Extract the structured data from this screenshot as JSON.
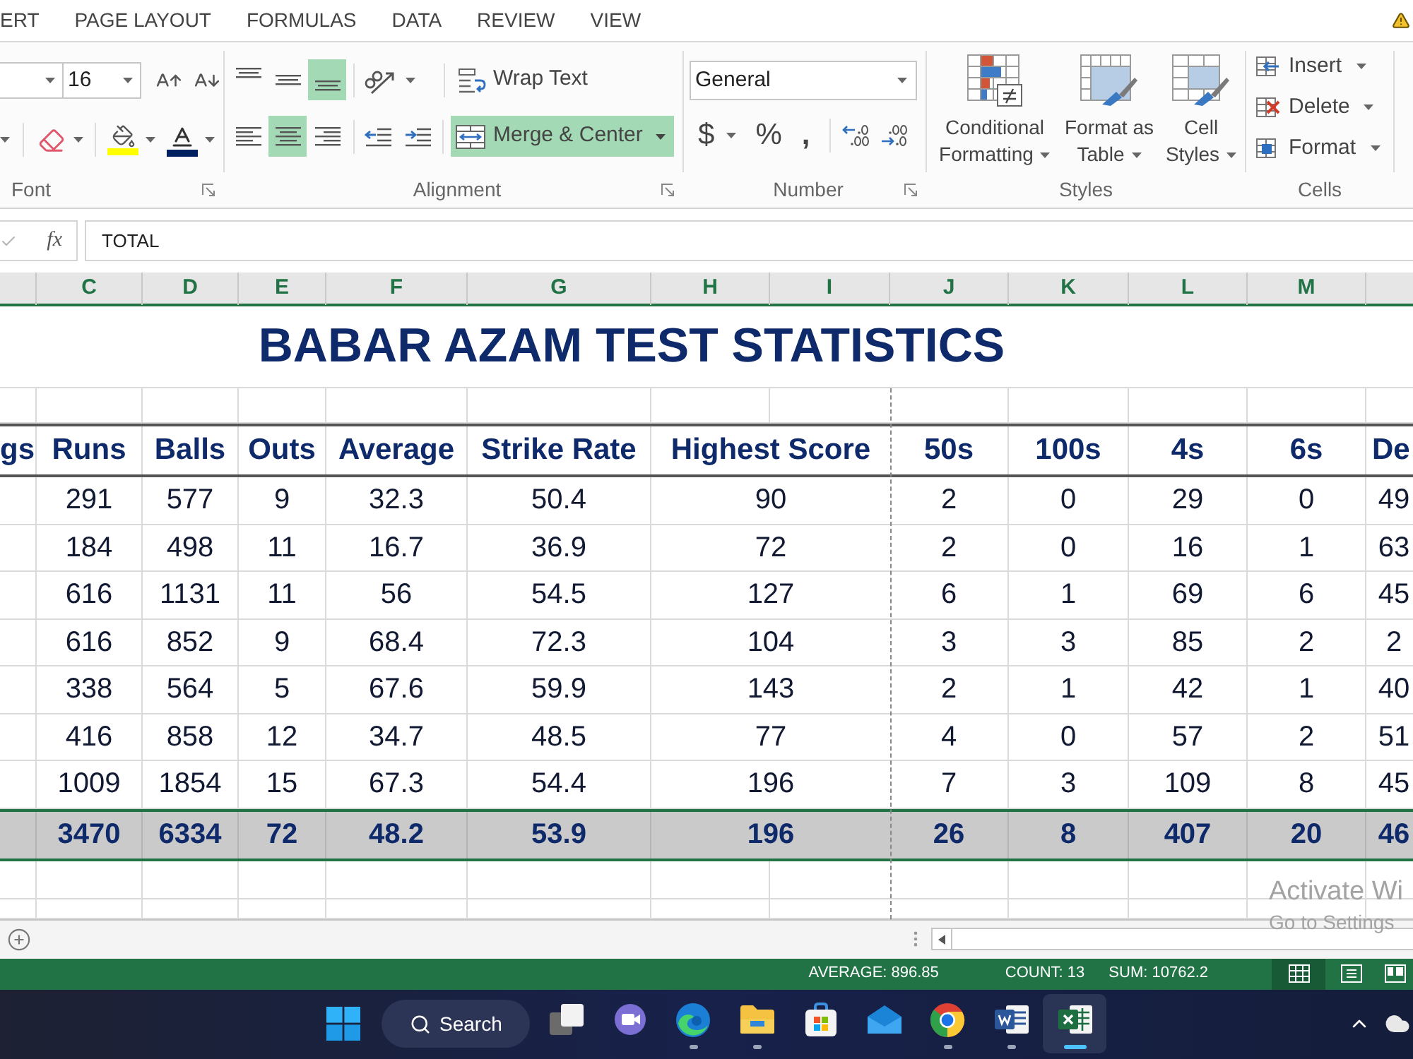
{
  "ribbon_tabs": [
    {
      "label": "ERT"
    },
    {
      "label": "PAGE LAYOUT"
    },
    {
      "label": "FORMULAS"
    },
    {
      "label": "DATA"
    },
    {
      "label": "REVIEW"
    },
    {
      "label": "VIEW"
    }
  ],
  "ribbon": {
    "font": {
      "label": "Font",
      "size": "16"
    },
    "alignment": {
      "label": "Alignment",
      "vertical": [
        {
          "kind": "top",
          "selected": false
        },
        {
          "kind": "middle",
          "selected": false
        },
        {
          "kind": "bottom",
          "selected": true
        }
      ],
      "horizontal": [
        {
          "kind": "left",
          "selected": false
        },
        {
          "kind": "center",
          "selected": true
        },
        {
          "kind": "right",
          "selected": false
        }
      ],
      "wrap_text": {
        "label": "Wrap Text",
        "selected": false
      },
      "merge": {
        "label": "Merge & Center",
        "selected": true
      }
    },
    "number": {
      "label": "Number",
      "format": "General",
      "symbols": [
        {
          "label": "$",
          "dropdown": true
        },
        {
          "label": "%",
          "dropdown": false
        },
        {
          "label": ",",
          "dropdown": false
        }
      ]
    },
    "styles": {
      "label": "Styles",
      "buttons": [
        {
          "kind": "conditional",
          "lines": [
            "Conditional",
            "Formatting"
          ]
        },
        {
          "kind": "table",
          "lines": [
            "Format as",
            "Table"
          ]
        },
        {
          "kind": "cell_styles",
          "lines": [
            "Cell",
            "Styles"
          ]
        }
      ]
    },
    "cells": {
      "label": "Cells",
      "buttons": [
        {
          "kind": "insert",
          "label": "Insert"
        },
        {
          "kind": "delete",
          "label": "Delete"
        },
        {
          "kind": "format",
          "label": "Format"
        }
      ]
    }
  },
  "formula_bar": {
    "function_label": "fx",
    "value": "TOTAL"
  },
  "column_headers": [
    {
      "label": "C",
      "selected": true
    },
    {
      "label": "D",
      "selected": true
    },
    {
      "label": "E",
      "selected": true
    },
    {
      "label": "F",
      "selected": true
    },
    {
      "label": "G",
      "selected": true
    },
    {
      "label": "H",
      "selected": true
    },
    {
      "label": "I",
      "selected": true
    },
    {
      "label": "J",
      "selected": true
    },
    {
      "label": "K",
      "selected": true
    },
    {
      "label": "L",
      "selected": true
    },
    {
      "label": "M",
      "selected": true
    }
  ],
  "sheet": {
    "title": "BABAR AZAM TEST STATISTICS",
    "headers": [
      "gs",
      "Runs",
      "Balls",
      "Outs",
      "Average",
      "Strike Rate",
      "Highest Score",
      "50s",
      "100s",
      "4s",
      "6s",
      "De"
    ],
    "rows": [
      [
        "",
        "291",
        "577",
        "9",
        "32.3",
        "50.4",
        "90",
        "2",
        "0",
        "29",
        "0",
        "49"
      ],
      [
        "",
        "184",
        "498",
        "11",
        "16.7",
        "36.9",
        "72",
        "2",
        "0",
        "16",
        "1",
        "63"
      ],
      [
        "",
        "616",
        "1131",
        "11",
        "56",
        "54.5",
        "127",
        "6",
        "1",
        "69",
        "6",
        "45"
      ],
      [
        "",
        "616",
        "852",
        "9",
        "68.4",
        "72.3",
        "104",
        "3",
        "3",
        "85",
        "2",
        "2"
      ],
      [
        "",
        "338",
        "564",
        "5",
        "67.6",
        "59.9",
        "143",
        "2",
        "1",
        "42",
        "1",
        "40"
      ],
      [
        "",
        "416",
        "858",
        "12",
        "34.7",
        "48.5",
        "77",
        "4",
        "0",
        "57",
        "2",
        "51"
      ],
      [
        "",
        "1009",
        "1854",
        "15",
        "67.3",
        "54.4",
        "196",
        "7",
        "3",
        "109",
        "8",
        "45"
      ]
    ],
    "total": {
      "selected": true,
      "values": [
        "3470",
        "6334",
        "72",
        "48.2",
        "53.9",
        "196",
        "26",
        "8",
        "407",
        "20",
        "46"
      ]
    }
  },
  "status_bar": {
    "items": [
      "AVERAGE: 896.85",
      "COUNT: 13",
      "SUM: 10762.2"
    ],
    "views": [
      {
        "kind": "normal",
        "selected": true
      },
      {
        "kind": "page_layout",
        "selected": false
      },
      {
        "kind": "page_break",
        "selected": false
      }
    ]
  },
  "activation_notice": {
    "title": "Activate Wi",
    "subtitle": "Go to Settings"
  },
  "taskbar": {
    "search": "Search",
    "apps": [
      {
        "kind": "task_view",
        "running": false,
        "selected": false
      },
      {
        "kind": "chat",
        "running": false,
        "selected": false
      },
      {
        "kind": "edge",
        "running": true,
        "selected": false
      },
      {
        "kind": "explorer",
        "running": true,
        "selected": false
      },
      {
        "kind": "store",
        "running": false,
        "selected": false
      },
      {
        "kind": "mail",
        "running": false,
        "selected": false
      },
      {
        "kind": "chrome",
        "running": true,
        "selected": false
      },
      {
        "kind": "word",
        "running": true,
        "selected": false
      },
      {
        "kind": "excel",
        "running": true,
        "selected": true
      }
    ]
  }
}
